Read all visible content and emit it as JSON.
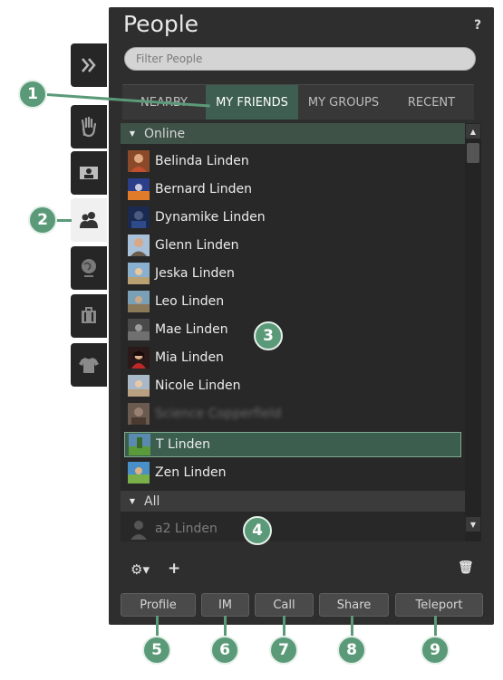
{
  "header": {
    "title": "People",
    "help_label": "?"
  },
  "filter": {
    "placeholder": "Filter People"
  },
  "tabs": [
    {
      "label": "NEARBY"
    },
    {
      "label": "MY FRIENDS",
      "active": true
    },
    {
      "label": "MY GROUPS"
    },
    {
      "label": "RECENT"
    }
  ],
  "groups": {
    "online_label": "Online",
    "all_label": "All"
  },
  "friends_online": [
    {
      "name": "Belinda Linden"
    },
    {
      "name": "Bernard Linden"
    },
    {
      "name": "Dynamike Linden"
    },
    {
      "name": "Glenn Linden"
    },
    {
      "name": "Jeska Linden"
    },
    {
      "name": "Leo Linden"
    },
    {
      "name": "Mae Linden"
    },
    {
      "name": "Mia Linden"
    },
    {
      "name": "Nicole Linden"
    },
    {
      "name": "Science Copperfield"
    },
    {
      "name": "T Linden",
      "selected": true
    },
    {
      "name": "Zen Linden"
    }
  ],
  "friends_all": [
    {
      "name": "a2 Linden"
    }
  ],
  "toolbar": {
    "gear_label": "⚙▾",
    "add_label": "+",
    "trash_label": "🗑"
  },
  "buttons": {
    "profile": "Profile",
    "im": "IM",
    "call": "Call",
    "share": "Share",
    "teleport": "Teleport"
  },
  "callouts": [
    "1",
    "2",
    "3",
    "4",
    "5",
    "6",
    "7",
    "8",
    "9"
  ],
  "colors": {
    "accent": "#3d5e50",
    "callout": "#5b9a78",
    "panel": "#2e2e2e"
  }
}
